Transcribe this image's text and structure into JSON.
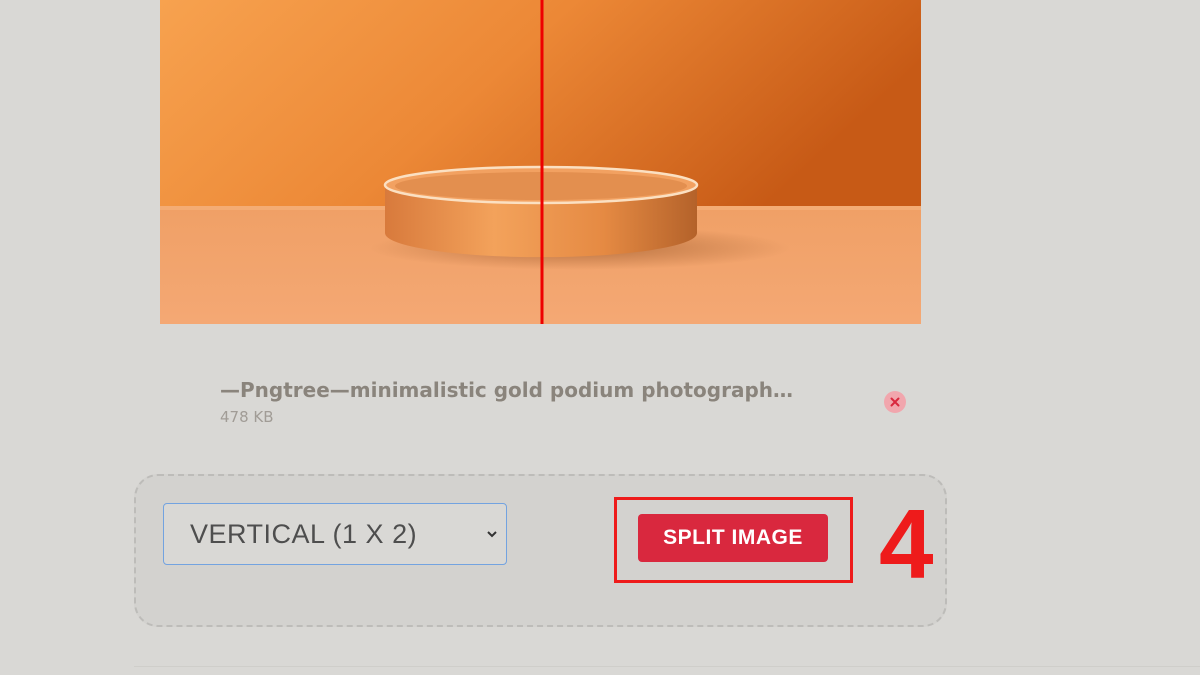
{
  "file": {
    "name": "—Pngtree—minimalistic gold podium photograph…",
    "size": "478 KB"
  },
  "options": {
    "split_mode": "VERTICAL (1 X 2)",
    "split_button_label": "SPLIT IMAGE"
  },
  "annotation": {
    "step_number": "4"
  },
  "colors": {
    "accent_button": "#d9283e",
    "annotation_red": "#ee1b1b",
    "split_line": "#ee0000",
    "background": "#d9d8d5"
  },
  "icons": {
    "remove": "close-icon",
    "select_arrow": "chevron-down-icon"
  }
}
